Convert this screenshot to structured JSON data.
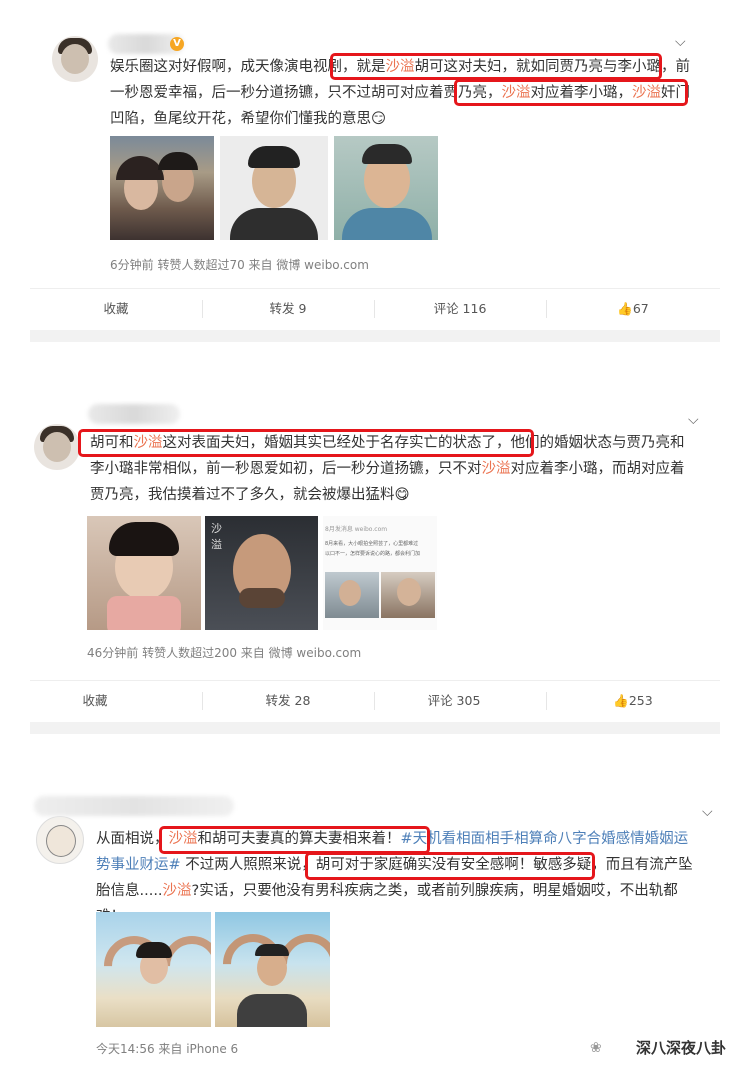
{
  "posts": [
    {
      "text_parts": [
        "娱乐圈这对好假啊，成天像演电视剧，",
        "就是",
        "沙溢",
        "胡可这对夫妇，就如同贾乃亮与李小璐，",
        "前一秒恩爱幸福，后一秒分道扬镳，只不过胡可对应着贾乃亮，",
        "沙溢",
        "对应着李小璐，",
        "沙溢",
        "奸门凹陷，",
        "鱼尾纹开花，希望你们懂我的意思"
      ],
      "emoji": "😏",
      "meta": "6分钟前 转赞人数超过70 来自 微博 weibo.com",
      "actions": {
        "fav": "收藏",
        "repost": "转发 9",
        "comment": "评论 116",
        "like": "67"
      }
    },
    {
      "text_parts": [
        "胡可和",
        "沙溢",
        "这对表面夫妇，婚姻其实已经处于名存实亡的状态了，",
        "他们的婚姻状态与贾乃亮和李小璐非常相似，前一秒恩爱如初，后一秒分道扬镳，只不对",
        "沙溢",
        "对应着李小璐，而胡对应着贾乃亮，我估摸着过不了多久，就会被爆出猛料"
      ],
      "emoji": "😋",
      "meta": "46分钟前 转赞人数超过200 来自 微博 weibo.com",
      "actions": {
        "fav": "收藏",
        "repost": "转发 28",
        "comment": "评论 305",
        "like": "253"
      }
    },
    {
      "text_parts": [
        "从面相说，",
        "沙溢",
        "和胡可夫妻真的算夫妻相来着！",
        "#天机看相面相手相算命八字合婚感情婚姻运势事业财运#",
        " 不过两人照照来说，",
        "胡可对于家庭确实没有安全感啊！敏感多疑",
        "，而且有流产坠胎信息.....",
        "沙溢",
        "?实话，只要他没有男科疾病之类，或者前列腺疾病，明星婚姻哎，不出轨都难！"
      ],
      "meta": "今天14:56 来自 iPhone 6"
    }
  ],
  "watermark": "深八深夜八卦",
  "thumb_text": {
    "line1": "8月发消息 weibo.com",
    "line2": "8月来看，大小眼拍全照芸了，心里都难过",
    "line3": "以口不一，怎样要诉说心的路，都会利门加"
  }
}
